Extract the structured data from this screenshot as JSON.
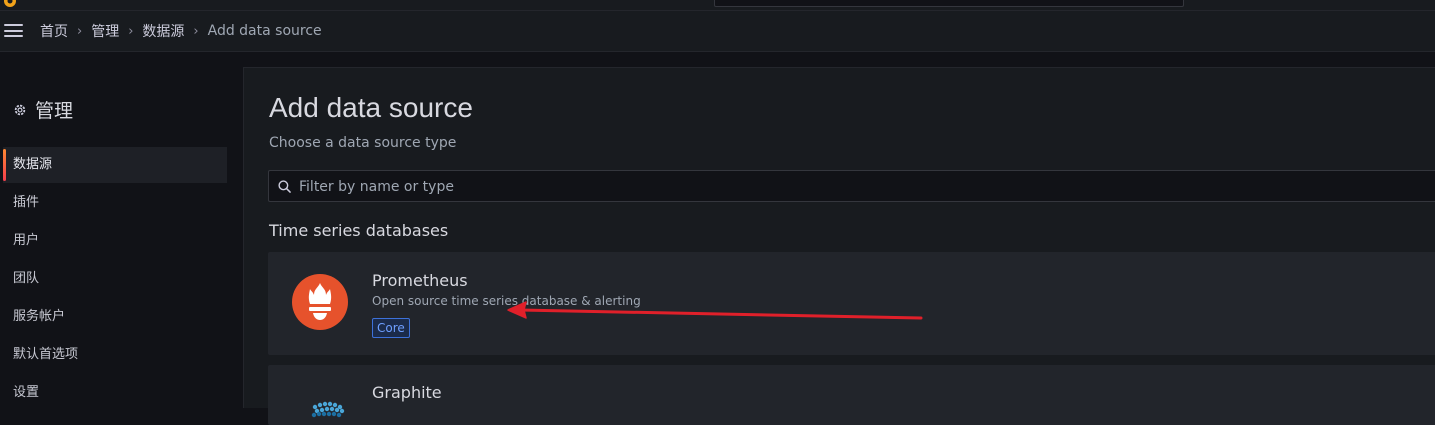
{
  "breadcrumb": {
    "home": "首页",
    "admin": "管理",
    "datasources": "数据源",
    "current": "Add data source"
  },
  "sidebar": {
    "title": "管理",
    "items": [
      {
        "label": "数据源",
        "active": true
      },
      {
        "label": "插件"
      },
      {
        "label": "用户"
      },
      {
        "label": "团队"
      },
      {
        "label": "服务帐户"
      },
      {
        "label": "默认首选项"
      },
      {
        "label": "设置"
      }
    ]
  },
  "main": {
    "title": "Add data source",
    "subtitle": "Choose a data source type",
    "filter_placeholder": "Filter by name or type",
    "section": "Time series databases",
    "cards": [
      {
        "name": "Prometheus",
        "description": "Open source time series database & alerting",
        "badge": "Core"
      },
      {
        "name": "Graphite"
      }
    ]
  },
  "colors": {
    "accent": "#f55f3e",
    "prometheus": "#e6522c",
    "annotation_arrow": "#e0202a",
    "badge_text": "#6e9fff"
  }
}
